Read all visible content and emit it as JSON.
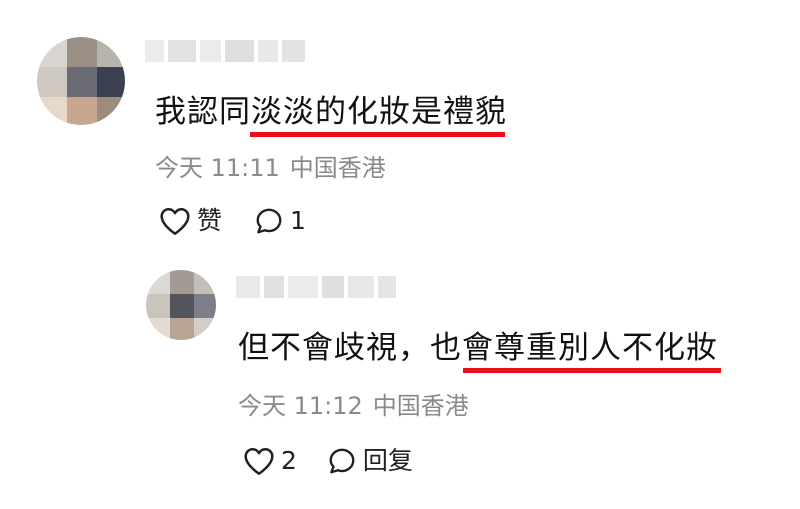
{
  "comments": [
    {
      "text_plain": "我認同",
      "text_marked": "淡淡的化妝是禮貌",
      "time": "今天 11:11",
      "location": "中国香港",
      "actions": {
        "like_label": "赞",
        "like_icon": "heart-outline-icon",
        "reply_count": "1",
        "reply_icon": "speech-bubble-icon"
      }
    },
    {
      "text_plain_before": "但不會歧視，也",
      "text_marked": "會尊重別人不化妝",
      "time": "今天 11:12",
      "location": "中国香港",
      "actions": {
        "like_count": "2",
        "like_icon": "heart-outline-icon",
        "reply_label": "回复",
        "reply_icon": "speech-bubble-icon"
      }
    }
  ],
  "colors": {
    "underline": "#e8101a",
    "meta_text": "#8a8a8a",
    "body_text": "#111111"
  }
}
